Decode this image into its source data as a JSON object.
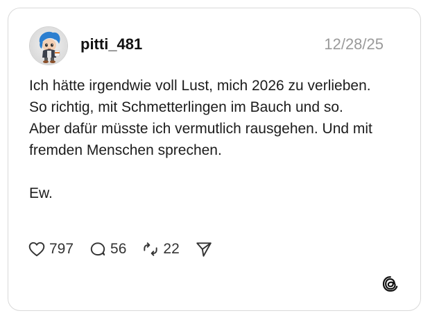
{
  "post": {
    "username": "pitti_481",
    "date": "12/28/25",
    "paragraph_1": "Ich hätte irgendwie voll Lust, mich 2026 zu verlieben. So richtig, mit Schmetterlingen im Bauch und so.",
    "paragraph_2": "Aber dafür müsste ich vermutlich rausgehen. Und mit fremden Menschen sprechen.",
    "paragraph_3": "Ew."
  },
  "actions": {
    "likes": "797",
    "comments": "56",
    "reposts": "22"
  },
  "icons": {
    "like": "heart-icon",
    "comment": "speech-bubble-icon",
    "repost": "repost-icon",
    "share": "paper-plane-icon",
    "brand": "threads-logo-icon"
  },
  "colors": {
    "date": "#9a9a9a",
    "border": "#d9d9d9",
    "text": "#1c1c1c"
  }
}
